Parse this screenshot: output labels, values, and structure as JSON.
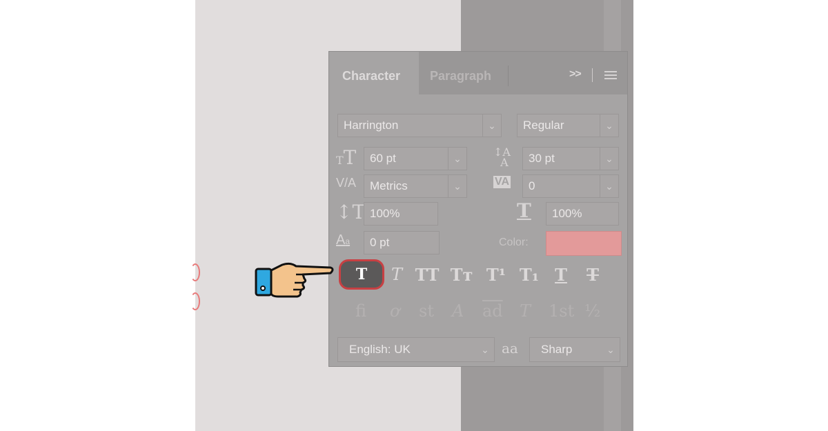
{
  "panel": {
    "tabs": [
      {
        "label": "Character",
        "active": true
      },
      {
        "label": "Paragraph",
        "active": false
      }
    ],
    "expand_label": ">>",
    "font_family": "Harrington",
    "font_style": "Regular",
    "font_size": "60 pt",
    "leading": "30 pt",
    "kerning": "Metrics",
    "tracking": "0",
    "vertical_scale": "100%",
    "horizontal_scale": "100%",
    "baseline_shift": "0 pt",
    "color_label": "Color:",
    "color_value": "#e39a9a",
    "format_buttons": [
      {
        "name": "faux-bold",
        "glyph": "T",
        "active": true
      },
      {
        "name": "faux-italic",
        "glyph": "T"
      },
      {
        "name": "all-caps",
        "glyph": "TT"
      },
      {
        "name": "small-caps",
        "glyph": "Tт"
      },
      {
        "name": "superscript",
        "glyph": "T¹"
      },
      {
        "name": "subscript",
        "glyph": "T₁"
      },
      {
        "name": "underline",
        "glyph": "T"
      },
      {
        "name": "strikethrough",
        "glyph": "T"
      }
    ],
    "opentype_buttons": [
      "fi",
      "ơ",
      "st",
      "A",
      "ad",
      "T",
      "1st",
      "½"
    ],
    "language": "English: UK",
    "anti_alias_icon": "aa",
    "anti_alias": "Sharp"
  },
  "colors": {
    "accent_highlight": "#c84043",
    "pointer_cuff": "#2fa8e0",
    "pointer_skin": "#f3c38c"
  }
}
